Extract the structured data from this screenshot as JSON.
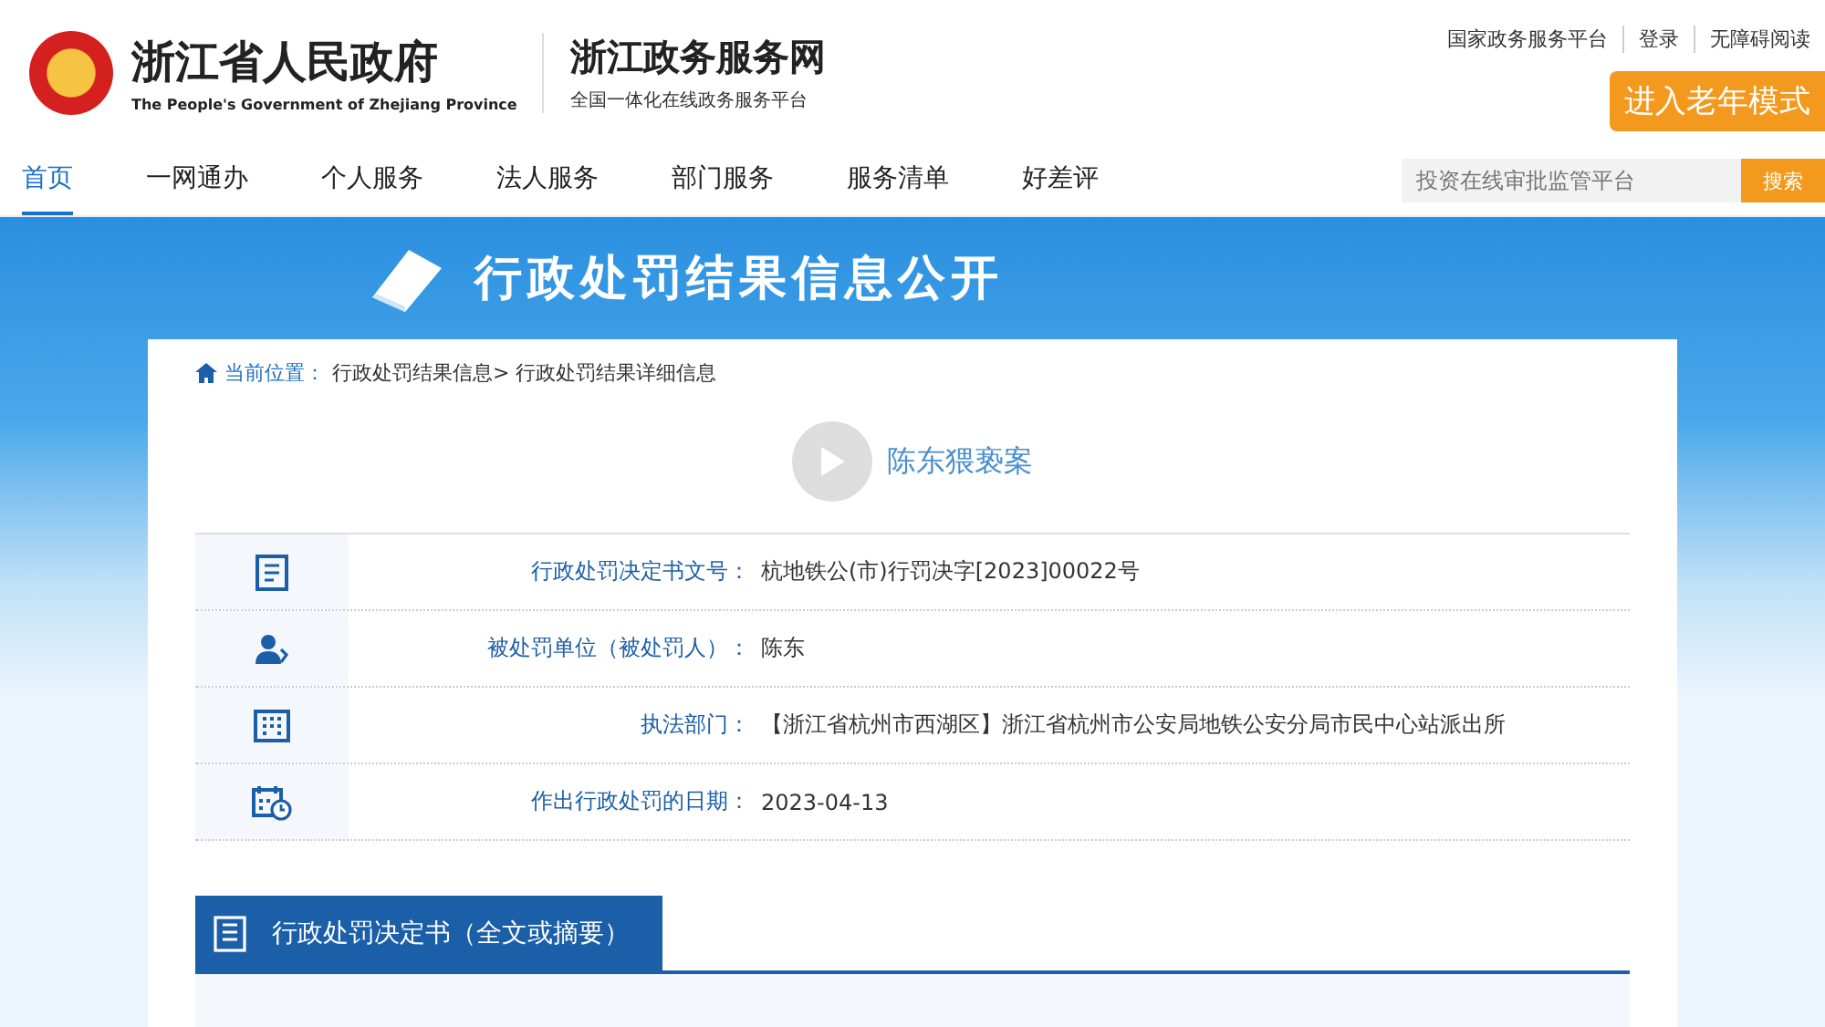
{
  "header": {
    "gov_name": "浙江省人民政府",
    "gov_name_en": "The People's Government of Zhejiang Province",
    "site_name": "浙江政务服务网",
    "site_slogan": "全国一体化在线政务服务平台",
    "top_links": [
      "国家政务服务平台",
      "登录",
      "无障碍阅读"
    ],
    "elder_mode": "进入老年模式"
  },
  "nav": [
    {
      "label": "首页",
      "selected": true
    },
    {
      "label": "一网通办",
      "selected": false
    },
    {
      "label": "个人服务",
      "selected": false
    },
    {
      "label": "法人服务",
      "selected": false
    },
    {
      "label": "部门服务",
      "selected": false
    },
    {
      "label": "服务清单",
      "selected": false
    },
    {
      "label": "好差评",
      "selected": false
    }
  ],
  "search": {
    "placeholder": "投资在线审批监管平台",
    "button": "搜索"
  },
  "banner": {
    "title": "行政处罚结果信息公开"
  },
  "breadcrumb": {
    "label": "当前位置：",
    "path": "行政处罚结果信息> 行政处罚结果详细信息"
  },
  "case_title": "陈东猥亵案",
  "rows": [
    {
      "kind": "document",
      "label": "行政处罚决定书文号：",
      "value": "杭地铁公(市)行罚决字[2023]00022号"
    },
    {
      "kind": "person",
      "label": "被处罚单位（被处罚人）：",
      "value": "陈东"
    },
    {
      "kind": "building",
      "label": "执法部门：",
      "value": "【浙江省杭州市西湖区】浙江省杭州市公安局地铁公安分局市民中心站派出所"
    },
    {
      "kind": "calendar",
      "label": "作出行政处罚的日期：",
      "value": "2023-04-13"
    }
  ],
  "section": {
    "title": "行政处罚决定书（全文或摘要）"
  }
}
